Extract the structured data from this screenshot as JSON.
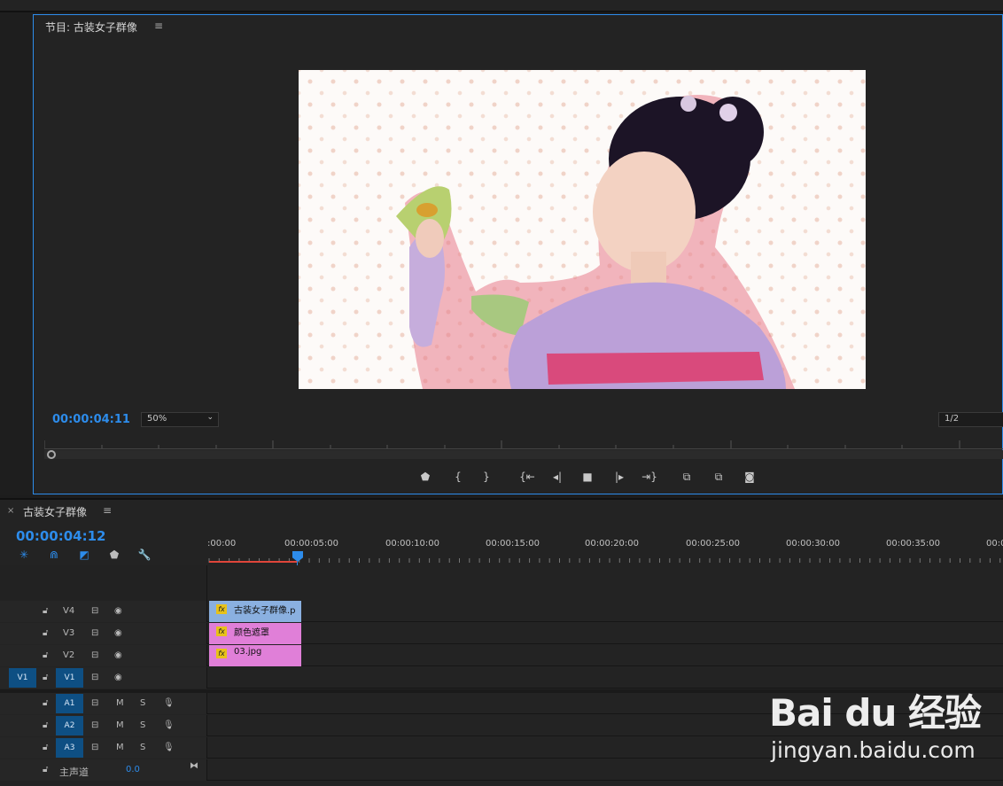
{
  "monitor": {
    "title": "节目: 古装女子群像",
    "menu_icon": "≡",
    "timecode": "00:00:04:11",
    "zoom": "50%",
    "resolution": "1/2",
    "preview_description_colors": {
      "background": "#fdfaf8",
      "dots": "#f0d3c8"
    }
  },
  "transport": {
    "buttons": [
      "add-marker",
      "mark-in",
      "mark-out",
      "go-to-in",
      "step-back",
      "stop",
      "step-forward",
      "go-to-out",
      "lift",
      "extract",
      "export-frame"
    ]
  },
  "timeline": {
    "close": "×",
    "title": "古装女子群像",
    "menu_icon": "≡",
    "timecode": "00:00:04:12",
    "ruler_labels": [
      ":00:00",
      "00:00:05:00",
      "00:00:10:00",
      "00:00:15:00",
      "00:00:20:00",
      "00:00:25:00",
      "00:00:30:00",
      "00:00:35:00",
      "00:0"
    ],
    "video_tracks": [
      {
        "id": "V4",
        "clip": "古装女子群像.p",
        "clip_color": "#8ab0e0"
      },
      {
        "id": "V3",
        "clip": "颜色遮罩",
        "clip_color": "#e07fd8"
      },
      {
        "id": "V2",
        "clip": "03.jpg",
        "clip_color": "#e07fd8"
      },
      {
        "id": "V1",
        "source_tag": "V1",
        "clip": "",
        "clip_color": ""
      }
    ],
    "audio_tracks": [
      {
        "id": "A1",
        "m": "M",
        "s": "S"
      },
      {
        "id": "A2",
        "m": "M",
        "s": "S"
      },
      {
        "id": "A3",
        "m": "M",
        "s": "S"
      }
    ],
    "master": {
      "label": "主声道",
      "value": "0.0"
    }
  },
  "watermark": {
    "logo": "Bai du 经验",
    "url": "jingyan.baidu.com"
  }
}
